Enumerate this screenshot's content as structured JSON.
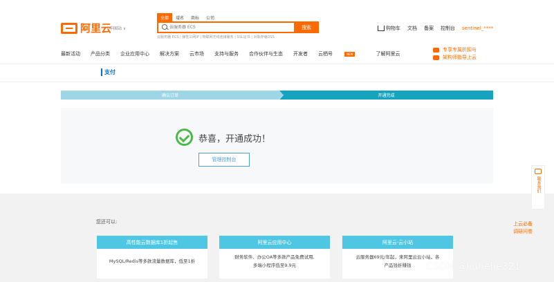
{
  "header": {
    "logo_text": "阿里云",
    "region": "中国站 ∨",
    "search_tabs": [
      "全部",
      "域名",
      "商标",
      "公司"
    ],
    "search_placeholder": "云服务器 ECS",
    "search_button": "搜索",
    "hot_links": "云服务器 ECS | 弹性公网IP | 物联网无线连接服务 | SSL证书 | 对象存储OSS",
    "cart": "购物车",
    "docs": "文档",
    "filing": "备案",
    "console": "控制台",
    "user": "sentinel_****"
  },
  "nav": {
    "items": [
      "最新活动",
      "产品分类",
      "企业应用中心",
      "解决方案",
      "云市场",
      "支持与服务",
      "合作伙伴与生态",
      "开发者",
      "云栖号",
      "了解阿里云"
    ],
    "new_badge": "NEW",
    "promo_1": "专享专属折扣与",
    "promo_2": "架构师指导上云"
  },
  "subnav": {
    "title": "支付"
  },
  "steps": {
    "step1": "确认订单",
    "step2": "开通完成"
  },
  "result": {
    "message": "恭喜，开通成功！",
    "console_button": "管理控制台"
  },
  "recommend": {
    "hint": "您还可以:",
    "cards": [
      {
        "title": "高性能云数据库1折起售",
        "line1": "MySQL/Redis等多款流量数据库，低至1折",
        "line2": ""
      },
      {
        "title": "阿里云应用中心",
        "line1": "财务软件、办公OA等多款产品免费试用,",
        "line2": "多端小程序低至9.9元"
      },
      {
        "title": "阿里云·云小站",
        "line1": "云服务器69元/年起，来阿里云云小站，各",
        "line2": "产品钱折赚钱"
      }
    ]
  },
  "side": {
    "contact": "联系我们",
    "survey_1": "上云必备",
    "survey_2": "调研问卷"
  },
  "watermark": "CSDN @liuhehe321",
  "colors": {
    "brand": "#ff6a00",
    "step_done": "#16a3bd",
    "card_head": "#4fc7e3",
    "success": "#4cb94b"
  }
}
